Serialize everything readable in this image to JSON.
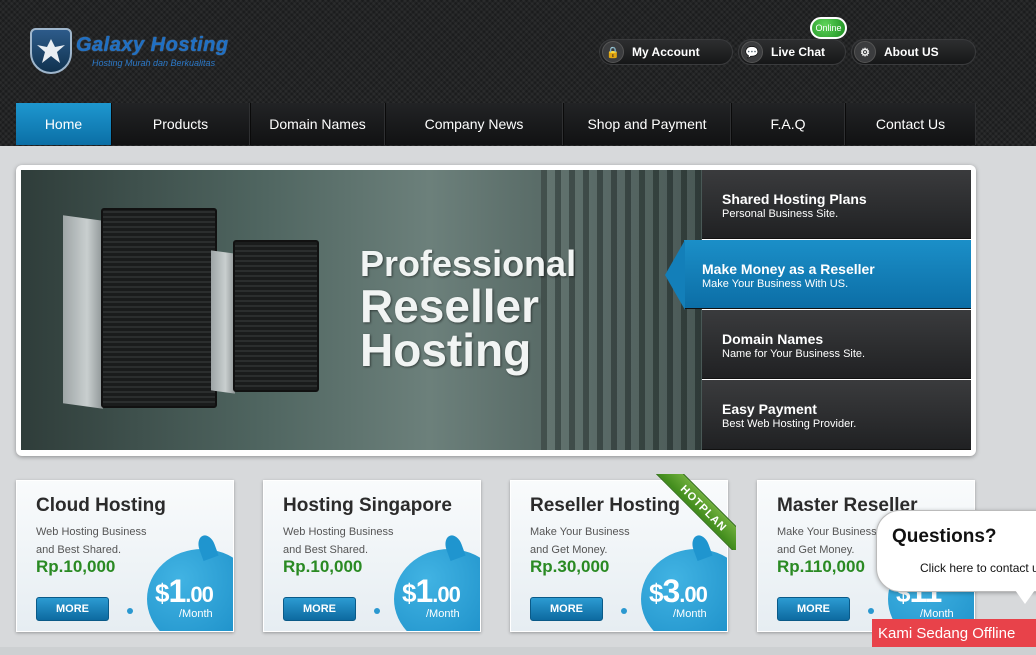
{
  "brand": {
    "title": "Galaxy Hosting",
    "tagline": "Hosting Murah dan Berkualitas"
  },
  "top_links": {
    "account": "My Account",
    "live_chat": "Live Chat",
    "about": "About US",
    "online_badge": "Online"
  },
  "nav": {
    "items": [
      "Home",
      "Products",
      "Domain Names",
      "Company News",
      "Shop and Payment",
      "F.A.Q",
      "Contact Us"
    ],
    "active": "Home"
  },
  "banner": {
    "headline_line1": "Professional",
    "headline_line2": "Reseller",
    "headline_line3": "Hosting",
    "tabs": [
      {
        "title": "Shared Hosting Plans",
        "subtitle": "Personal Business Site."
      },
      {
        "title": "Make Money as a Reseller",
        "subtitle": "Make Your Business With US."
      },
      {
        "title": "Domain Names",
        "subtitle": "Name for Your Business Site."
      },
      {
        "title": "Easy Payment",
        "subtitle": "Best Web Hosting Provider."
      }
    ],
    "active_tab": "Make Money as a Reseller"
  },
  "plans": [
    {
      "title": "Cloud Hosting",
      "desc1": "Web Hosting Business",
      "desc2": "and Best Shared.",
      "price": "Rp.10,000",
      "dollar": "$",
      "amount": "1",
      "cents": ".00",
      "per": "/Month",
      "more": "MORE"
    },
    {
      "title": "Hosting Singapore",
      "desc1": "Web Hosting Business",
      "desc2": "and Best Shared.",
      "price": "Rp.10,000",
      "dollar": "$",
      "amount": "1",
      "cents": ".00",
      "per": "/Month",
      "more": "MORE"
    },
    {
      "title": "Reseller Hosting",
      "desc1": "Make Your Business",
      "desc2": "and Get Money.",
      "price": "Rp.30,000",
      "dollar": "$",
      "amount": "3",
      "cents": ".00",
      "per": "/Month",
      "more": "MORE"
    },
    {
      "title": "Master Reseller",
      "desc1": "Make Your Business",
      "desc2": "and Get Money.",
      "price": "Rp.110,000",
      "dollar": "$",
      "amount": "11",
      "cents": "",
      "per": "/Month",
      "more": "MORE"
    }
  ],
  "hotplan_ribbon": "HOTPLAN",
  "chat_widget": {
    "title": "Questions?",
    "subtitle": "Click here to contact us",
    "status": "Kami Sedang Offline"
  },
  "colors": {
    "accent": "#1a8fc8",
    "price_green": "#2a8a23",
    "offline_red": "#e8424a"
  }
}
